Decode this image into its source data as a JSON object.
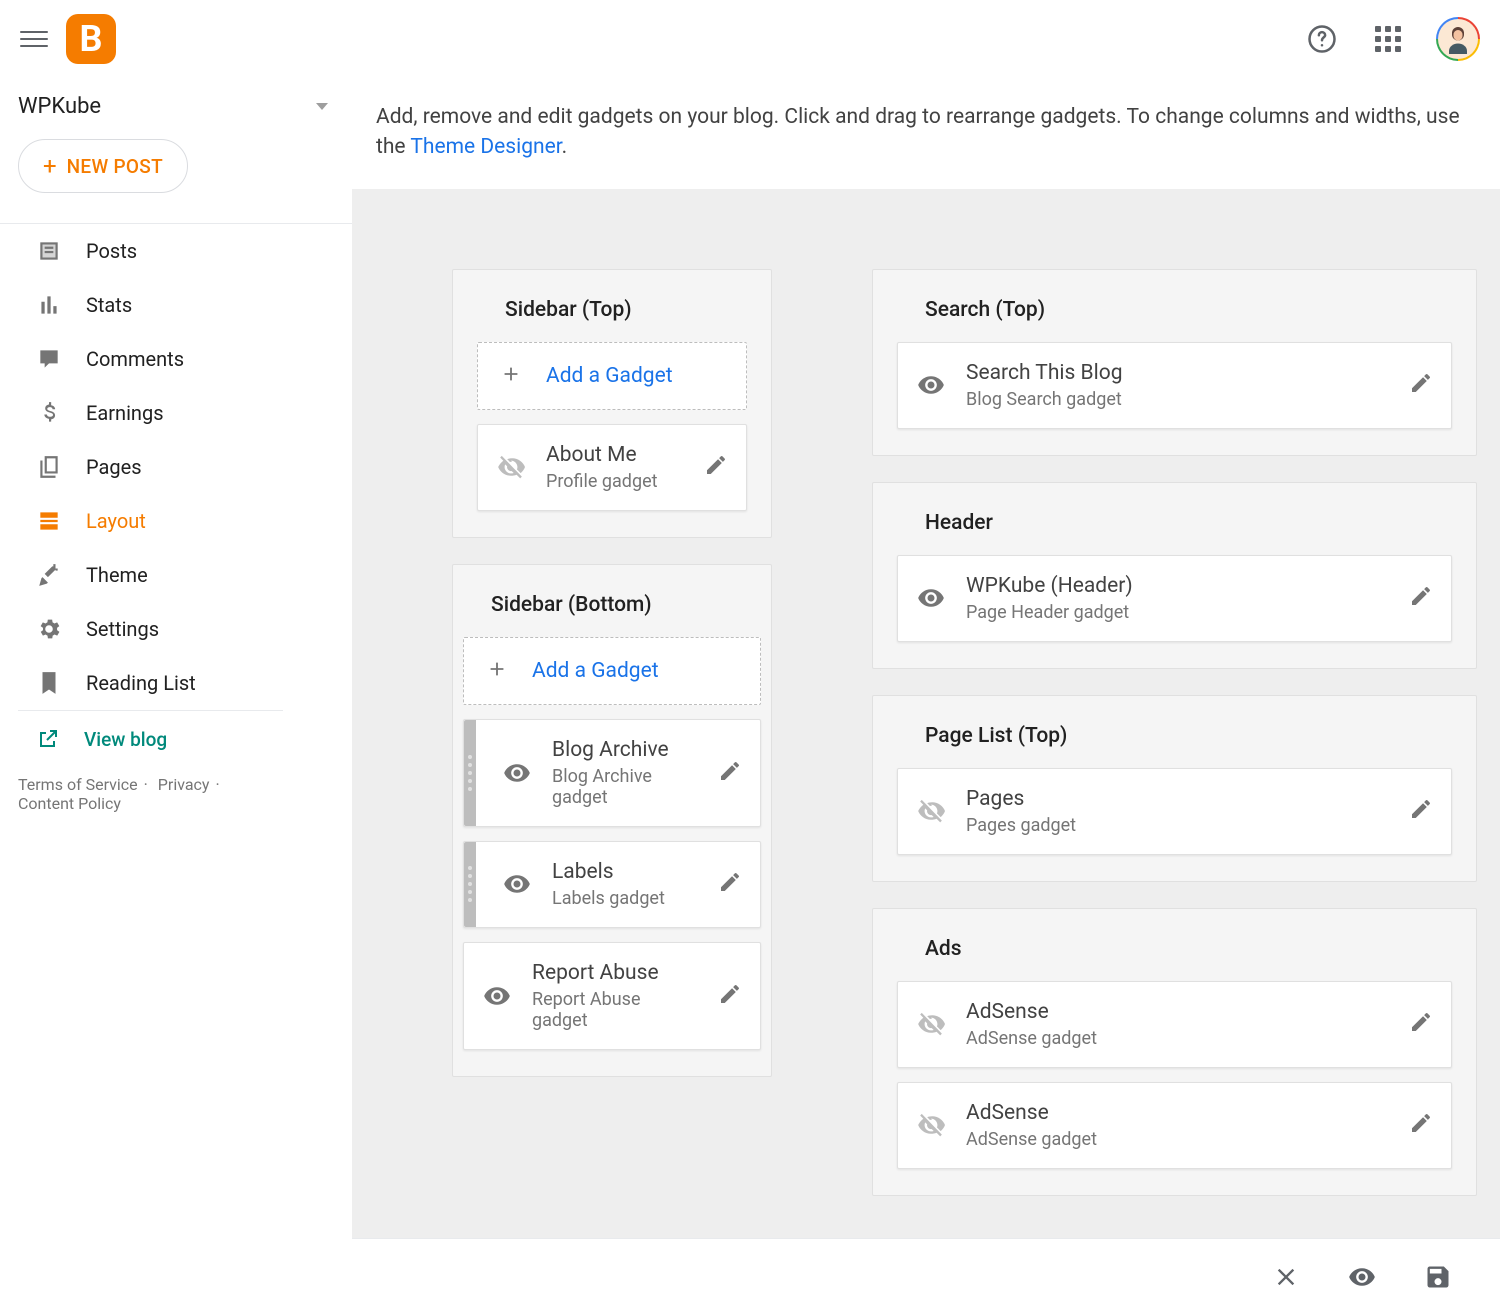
{
  "blogName": "WPKube",
  "newPostLabel": "NEW POST",
  "nav": {
    "posts": "Posts",
    "stats": "Stats",
    "comments": "Comments",
    "earnings": "Earnings",
    "pages": "Pages",
    "layout": "Layout",
    "theme": "Theme",
    "settings": "Settings",
    "readingList": "Reading List",
    "viewBlog": "View blog"
  },
  "footer": {
    "terms": "Terms of Service",
    "privacy": "Privacy",
    "contentPolicy": "Content Policy"
  },
  "info": {
    "text": "Add, remove and edit gadgets on your blog. Click and drag to rearrange gadgets. To change columns and widths, use the ",
    "linkText": "Theme Designer",
    "suffix": "."
  },
  "addGadget": "Add a Gadget",
  "sections": {
    "sidebarTop": {
      "title": "Sidebar (Top)",
      "gadgets": [
        {
          "title": "About Me",
          "sub": "Profile gadget",
          "visible": false,
          "draggable": false
        }
      ]
    },
    "sidebarBottom": {
      "title": "Sidebar (Bottom)",
      "gadgets": [
        {
          "title": "Blog Archive",
          "sub": "Blog Archive gadget",
          "visible": true,
          "draggable": true
        },
        {
          "title": "Labels",
          "sub": "Labels gadget",
          "visible": true,
          "draggable": true
        },
        {
          "title": "Report Abuse",
          "sub": "Report Abuse gadget",
          "visible": true,
          "draggable": false
        }
      ]
    },
    "searchTop": {
      "title": "Search (Top)",
      "gadgets": [
        {
          "title": "Search This Blog",
          "sub": "Blog Search gadget",
          "visible": true,
          "draggable": false
        }
      ]
    },
    "header": {
      "title": "Header",
      "gadgets": [
        {
          "title": "WPKube (Header)",
          "sub": "Page Header gadget",
          "visible": true,
          "draggable": false
        }
      ]
    },
    "pageList": {
      "title": "Page List (Top)",
      "gadgets": [
        {
          "title": "Pages",
          "sub": "Pages gadget",
          "visible": false,
          "draggable": false
        }
      ]
    },
    "ads": {
      "title": "Ads",
      "gadgets": [
        {
          "title": "AdSense",
          "sub": "AdSense gadget",
          "visible": false,
          "draggable": false
        },
        {
          "title": "AdSense",
          "sub": "AdSense gadget",
          "visible": false,
          "draggable": false
        }
      ]
    }
  }
}
